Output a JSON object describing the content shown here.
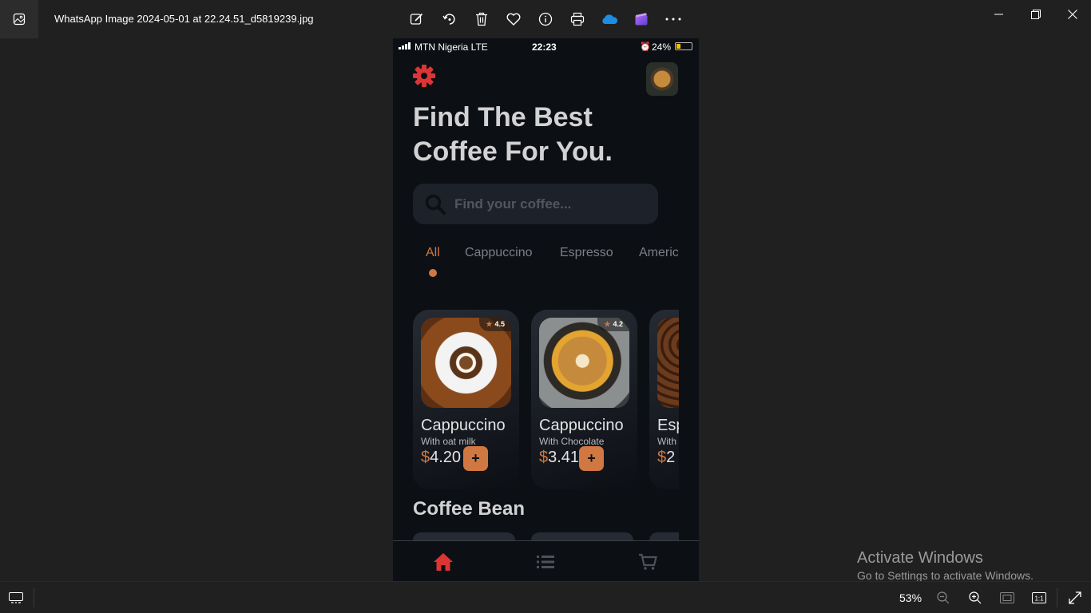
{
  "window": {
    "title": "WhatsApp Image 2024-05-01 at 22.24.51_d5819239.jpg",
    "toolbar_icons": [
      "edit-icon",
      "rotate-icon",
      "delete-icon",
      "favorite-icon",
      "info-icon",
      "print-icon",
      "onedrive-icon",
      "clipchamp-icon",
      "more-icon"
    ],
    "controls": [
      "minimize-icon",
      "restore-icon",
      "close-icon"
    ]
  },
  "phone": {
    "status": {
      "carrier": "MTN Nigeria  LTE",
      "time": "22:23",
      "battery": "24%"
    },
    "headline": "Find The Best Coffee For You.",
    "search_placeholder": "Find your coffee...",
    "tabs": [
      "All",
      "Cappuccino",
      "Espresso",
      "Americ"
    ],
    "active_tab": "All",
    "cards": [
      {
        "rating": "4.5",
        "name": "Cappuccino",
        "subtitle": "With oat milk",
        "currency": "$",
        "price": "4.20",
        "add": "+"
      },
      {
        "rating": "4.2",
        "name": "Cappuccino",
        "subtitle": "With Chocolate",
        "currency": "$",
        "price": "3.41",
        "add": "+"
      },
      {
        "rating": "",
        "name": "Esp",
        "subtitle": "With",
        "currency": "$",
        "price": "2",
        "add": "+"
      }
    ],
    "section_title": "Coffee Bean",
    "nav": [
      "home-icon",
      "list-icon",
      "cart-icon"
    ],
    "accent_color": "#d17842",
    "nav_active_color": "#dc3535"
  },
  "watermark": {
    "line1": "Activate Windows",
    "line2": "Go to Settings to activate Windows."
  },
  "statusbar": {
    "zoom": "53%"
  }
}
